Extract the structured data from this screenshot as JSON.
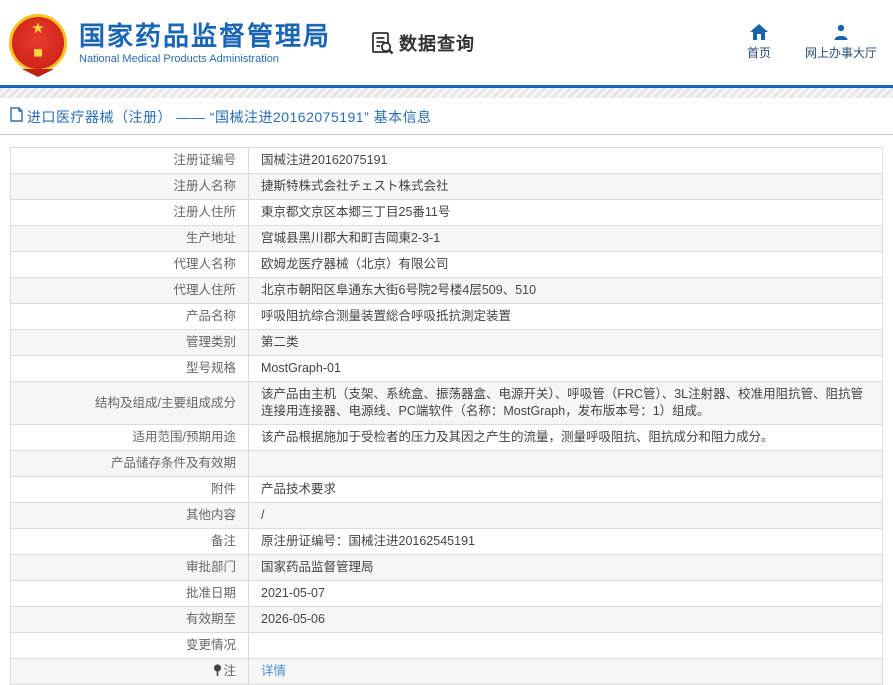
{
  "header": {
    "title_cn": "国家药品监督管理局",
    "title_en": "National Medical Products Administration",
    "section_label": "数据查询",
    "nav": [
      {
        "label": "首页",
        "icon": "home-icon"
      },
      {
        "label": "网上办事大厅",
        "icon": "person-icon"
      }
    ]
  },
  "breadcrumb": {
    "text": "进口医疗器械（注册） —— “国械注进20162075191” 基本信息"
  },
  "table": {
    "rows": [
      {
        "label": "注册证编号",
        "value": "国械注进20162075191"
      },
      {
        "label": "注册人名称",
        "value": "捷斯特株式会社チェスト株式会社"
      },
      {
        "label": "注册人住所",
        "value": "東京都文京区本郷三丁目25番11号"
      },
      {
        "label": "生产地址",
        "value": "宫城县黑川郡大和町吉岡東2-3-1"
      },
      {
        "label": "代理人名称",
        "value": "欧姆龙医疗器械（北京）有限公司"
      },
      {
        "label": "代理人住所",
        "value": "北京市朝阳区阜通东大街6号院2号楼4层509、510"
      },
      {
        "label": "产品名称",
        "value": "呼吸阻抗综合测量装置総合呼吸抵抗測定装置"
      },
      {
        "label": "管理类别",
        "value": "第二类"
      },
      {
        "label": "型号规格",
        "value": "MostGraph-01"
      },
      {
        "label": "结构及组成/主要组成成分",
        "value": "该产品由主机（支架、系统盒、振荡器盒、电源开关）、呼吸管（FRC管）、3L注射器、校准用阻抗管、阻抗管连接用连接器、电源线、PC端软件（名称：MostGraph，发布版本号：1）组成。"
      },
      {
        "label": "适用范围/预期用途",
        "value": "该产品根据施加于受检者的压力及其因之产生的流量，测量呼吸阻抗、阻抗成分和阻力成分。"
      },
      {
        "label": "产品储存条件及有效期",
        "value": ""
      },
      {
        "label": "附件",
        "value": "产品技术要求"
      },
      {
        "label": "其他内容",
        "value": "/"
      },
      {
        "label": "备注",
        "value": "原注册证编号：国械注进20162545191"
      },
      {
        "label": "审批部门",
        "value": "国家药品监督管理局"
      },
      {
        "label": "批准日期",
        "value": "2021-05-07"
      },
      {
        "label": "有效期至",
        "value": "2026-05-06"
      },
      {
        "label": "变更情况",
        "value": ""
      },
      {
        "label": "注",
        "label_icon": "pin-icon",
        "value": "详情",
        "link": true
      }
    ]
  },
  "colors": {
    "brand_blue": "#1b65b5",
    "rule_blue": "#1763ae",
    "crumb_blue": "#2a6db4",
    "link_blue": "#4d8fd1",
    "alt_row": "#f6f6f6",
    "emblem_red": "#d2241a",
    "emblem_gold": "#f4c31f"
  }
}
